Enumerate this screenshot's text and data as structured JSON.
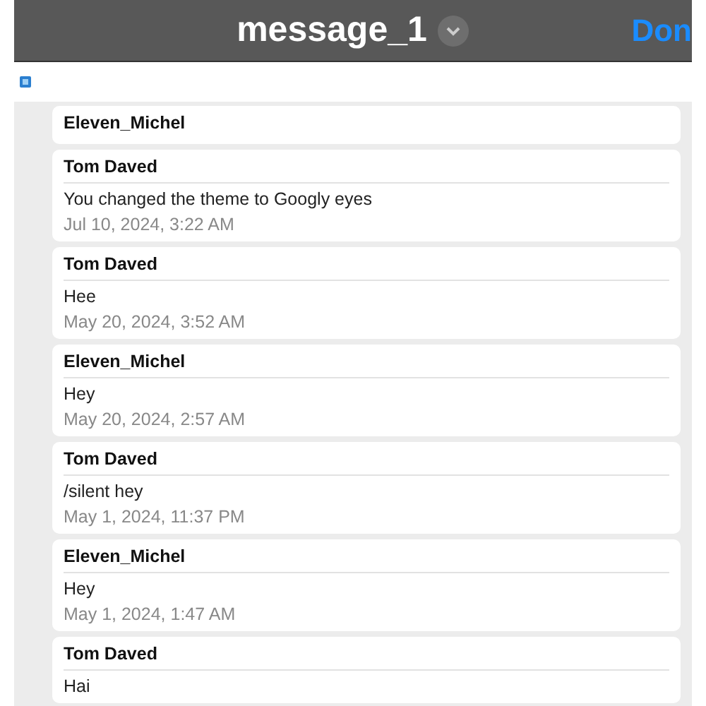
{
  "header": {
    "title": "message_1",
    "done": "Don"
  },
  "messages": [
    {
      "sender": "Eleven_Michel"
    },
    {
      "sender": "Tom Daved",
      "text": "You changed the theme to Googly eyes",
      "time": "Jul 10, 2024, 3:22 AM"
    },
    {
      "sender": "Tom Daved",
      "text": "Hee",
      "time": "May 20, 2024, 3:52 AM"
    },
    {
      "sender": "Eleven_Michel",
      "text": "Hey",
      "time": "May 20, 2024, 2:57 AM"
    },
    {
      "sender": "Tom Daved",
      "text": "/silent hey",
      "time": "May 1, 2024, 11:37 PM"
    },
    {
      "sender": "Eleven_Michel",
      "text": "Hey",
      "time": "May 1, 2024, 1:47 AM"
    },
    {
      "sender": "Tom Daved",
      "text": "Hai"
    }
  ]
}
